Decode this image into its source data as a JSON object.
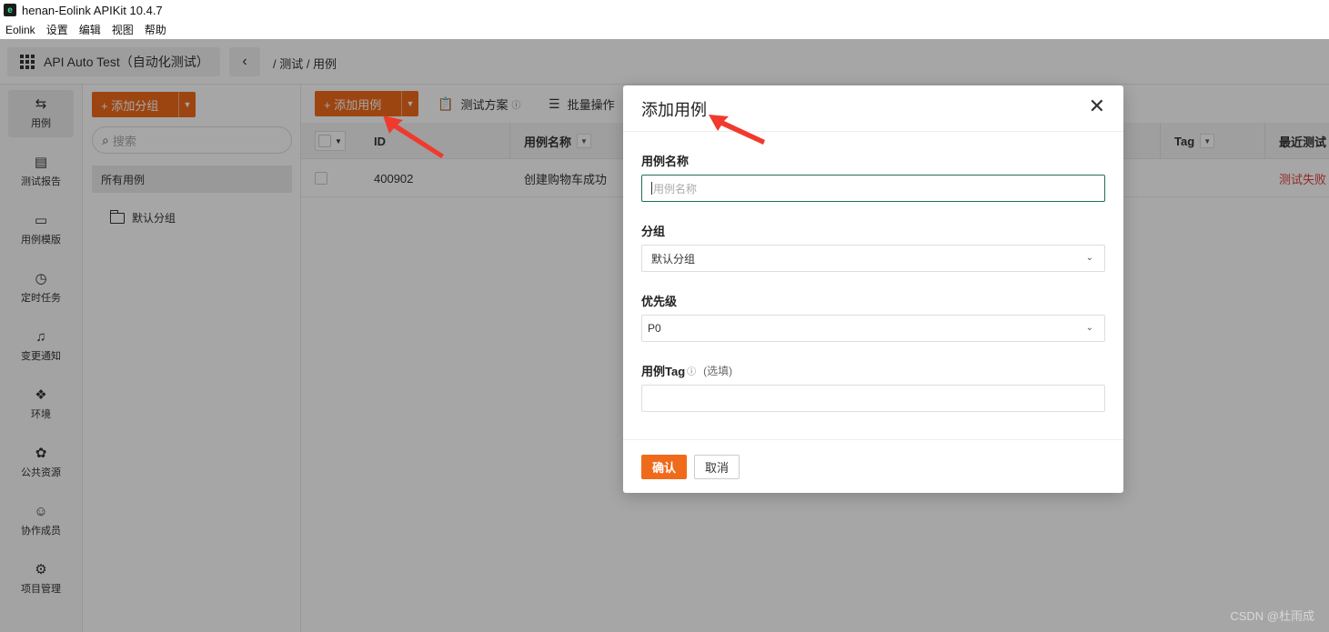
{
  "window": {
    "title": "henan-Eolink APIKit 10.4.7",
    "logo_glyph": "e"
  },
  "menu": [
    "Eolink",
    "设置",
    "编辑",
    "视图",
    "帮助"
  ],
  "topbar": {
    "project_name": "API Auto Test（自动化测试）",
    "back_glyph": "‹",
    "breadcrumb": "/ 测试 / 用例"
  },
  "sidebar": {
    "items": [
      {
        "label": "用例",
        "icon": "⇆",
        "active": true
      },
      {
        "label": "测试报告",
        "icon": "▤"
      },
      {
        "label": "用例模版",
        "icon": "▭"
      },
      {
        "label": "定时任务",
        "icon": "◷"
      },
      {
        "label": "变更通知",
        "icon": "♫"
      },
      {
        "label": "环境",
        "icon": "❖"
      },
      {
        "label": "公共资源",
        "icon": "✿"
      },
      {
        "label": "协作成员",
        "icon": "☺"
      },
      {
        "label": "项目管理",
        "icon": "⚙"
      }
    ]
  },
  "groups": {
    "add_button": "+ 添加分组",
    "search_placeholder": "搜索",
    "all_cases": "所有用例",
    "default_group": "默认分组"
  },
  "toolbar": {
    "add_case": "+ 添加用例",
    "test_plan": "测试方案",
    "test_plan_info": "ⓘ",
    "batch_ops": "批量操作"
  },
  "table": {
    "headers": {
      "id": "ID",
      "name": "用例名称",
      "tag": "Tag",
      "last_test": "最近测试"
    },
    "rows": [
      {
        "id": "400902",
        "name": "创建购物车成功",
        "last_test": "测试失败"
      }
    ]
  },
  "modal": {
    "title": "添加用例",
    "close_glyph": "✕",
    "fields": {
      "name_label": "用例名称",
      "name_placeholder": "用例名称",
      "name_value": "",
      "group_label": "分组",
      "group_value": "默认分组",
      "priority_label": "优先级",
      "priority_value": "P0",
      "tag_label": "用例Tag",
      "tag_info": "ⓘ",
      "tag_optional": "(选填)",
      "tag_value": ""
    },
    "confirm": "确认",
    "cancel": "取消"
  },
  "watermark": "CSDN @杜雨成",
  "colors": {
    "accent": "#f06a1b",
    "focus_border": "#1f6f5c",
    "fail": "#e43f3f",
    "annotation": "#f03a2e"
  }
}
